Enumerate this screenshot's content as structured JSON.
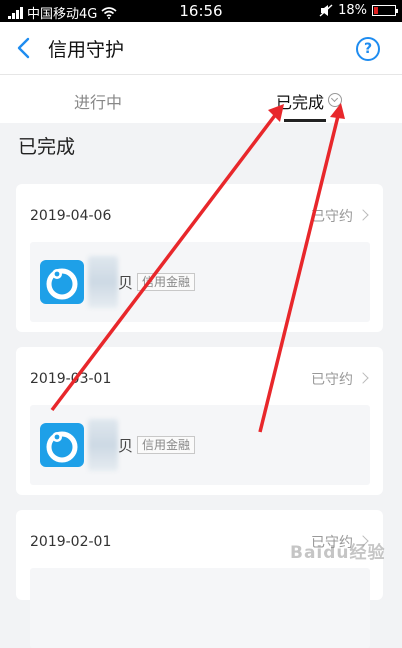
{
  "status_bar": {
    "carrier": "中国移动4G",
    "time": "16:56",
    "battery": "18%"
  },
  "nav": {
    "title": "信用守护",
    "help_glyph": "?"
  },
  "tabs": [
    {
      "label": "进行中"
    },
    {
      "label": "已完成"
    }
  ],
  "section_title": "已完成",
  "cards": [
    {
      "date": "2019-04-06",
      "status": "已守约",
      "partial_char": "贝",
      "tag": "信用金融"
    },
    {
      "date": "2019-03-01",
      "status": "已守约",
      "partial_char": "贝",
      "tag": "信用金融"
    },
    {
      "date": "2019-02-01",
      "status": "已守约"
    }
  ],
  "watermark": "Baidu经验",
  "colors": {
    "accent": "#1e8cf0",
    "app_icon": "#1ea0e8",
    "annotation_arrow": "#e8272b",
    "background": "#f2f3f5"
  }
}
